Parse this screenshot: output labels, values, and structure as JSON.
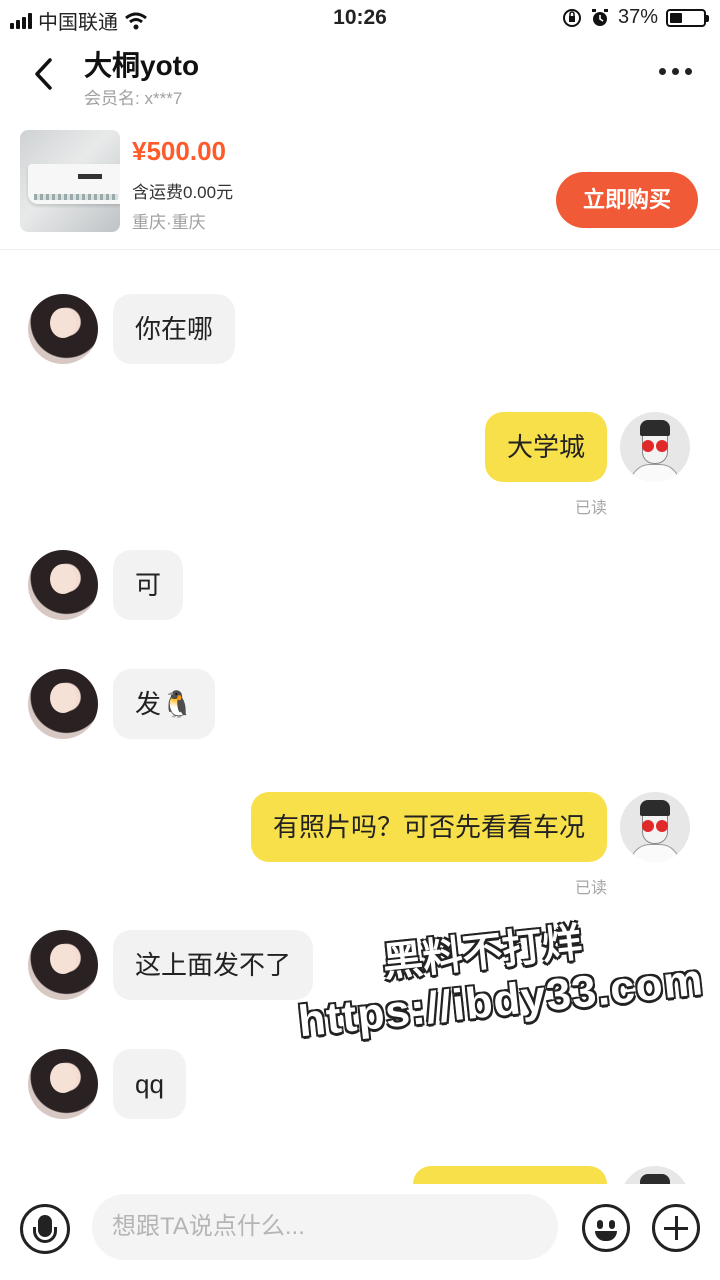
{
  "status_bar": {
    "carrier": "中国联通",
    "time": "10:26",
    "battery_level": "37%",
    "icons": [
      "signal-icon",
      "wifi-icon",
      "orientation-lock-icon",
      "alarm-icon",
      "battery-icon"
    ]
  },
  "header": {
    "title": "大桐yoto",
    "member_label": "会员名:",
    "member_value": "x***7",
    "back_icon": "chevron-left-icon",
    "more_icon": "more-icon"
  },
  "product": {
    "price": "¥500.00",
    "shipping": "含运费0.00元",
    "location": "重庆·重庆",
    "buy_label": "立即购买",
    "accent_color": "#ff5a2a",
    "button_color": "#f05a36"
  },
  "messages": [
    {
      "side": "in",
      "text": "你在哪"
    },
    {
      "side": "out",
      "text": "大学城",
      "status": "已读"
    },
    {
      "side": "in",
      "text": "可"
    },
    {
      "side": "in",
      "text": "发🐧"
    },
    {
      "side": "out",
      "text": "有照片吗？可否先看看车况",
      "status": "已读"
    },
    {
      "side": "in",
      "text": "这上面发不了"
    },
    {
      "side": "in",
      "text": "qq"
    }
  ],
  "watermark": {
    "line1": "黑料不打烊",
    "line2": "https://ibdy33.com"
  },
  "input_bar": {
    "placeholder": "想跟TA说点什么...",
    "bubble_out_color": "#f8e04a",
    "bubble_in_color": "#f2f2f3"
  }
}
